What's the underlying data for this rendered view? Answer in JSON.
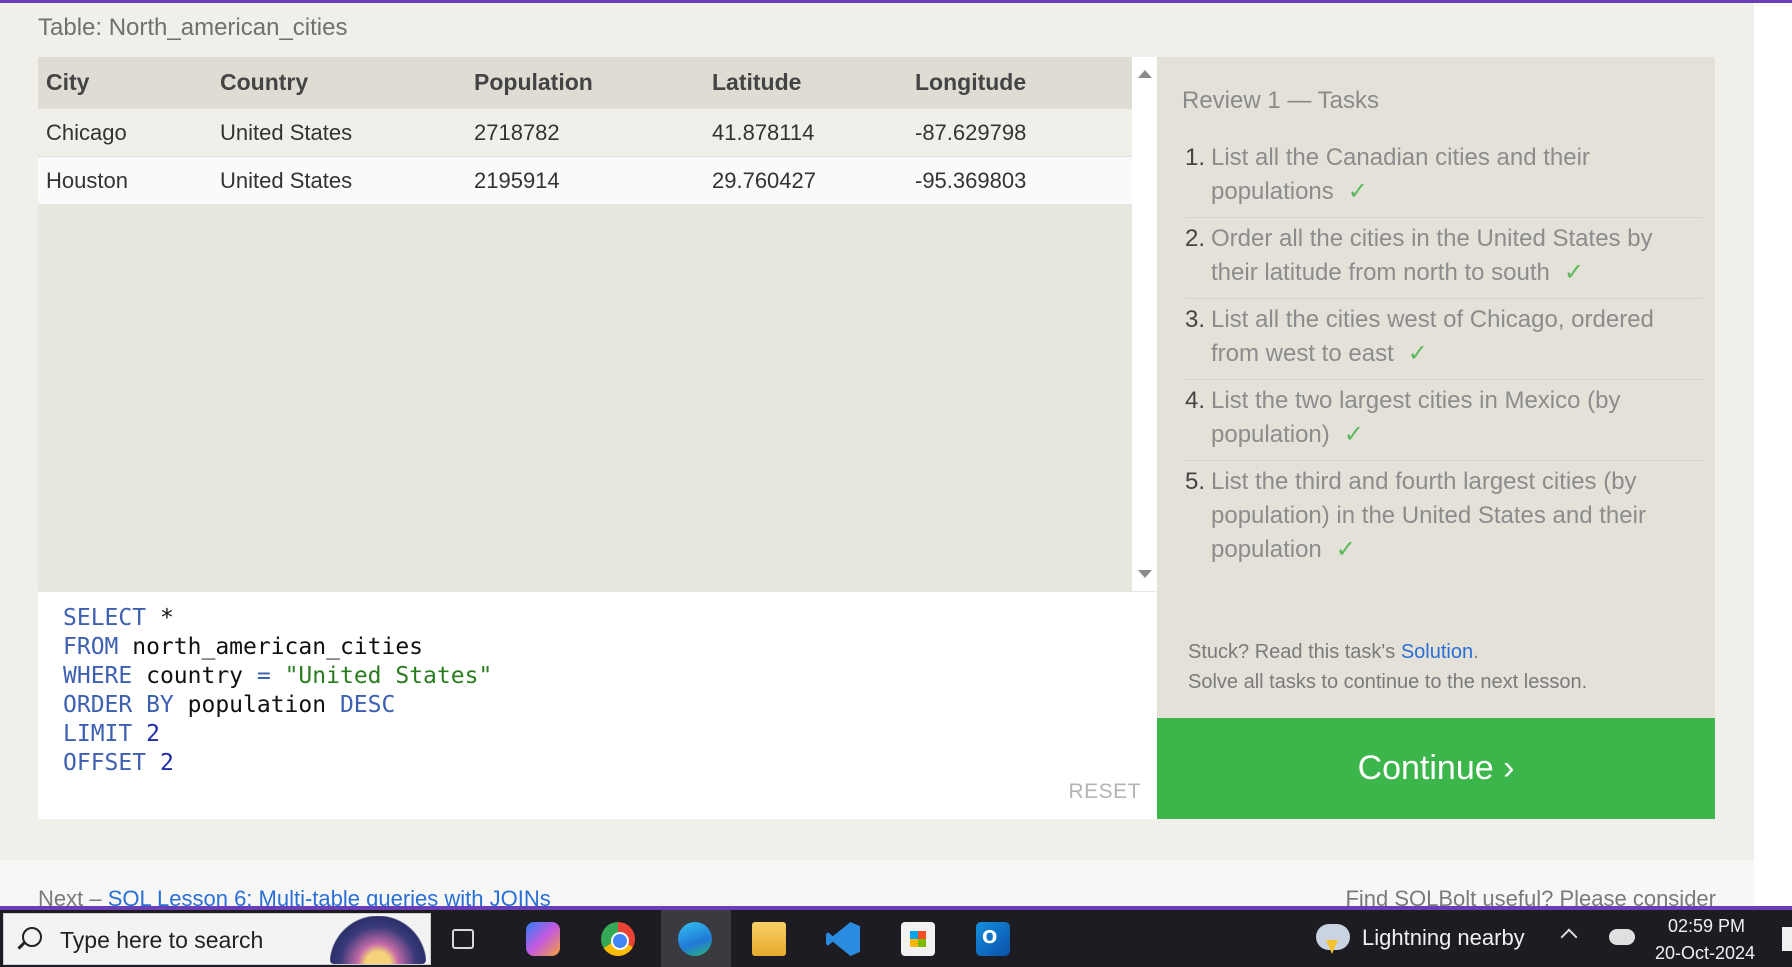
{
  "table": {
    "caption": "Table: North_american_cities",
    "columns": [
      "City",
      "Country",
      "Population",
      "Latitude",
      "Longitude"
    ],
    "rows": [
      [
        "Chicago",
        "United States",
        "2718782",
        "41.878114",
        "-87.629798"
      ],
      [
        "Houston",
        "United States",
        "2195914",
        "29.760427",
        "-95.369803"
      ]
    ]
  },
  "editor": {
    "lines": [
      [
        {
          "t": "SELECT",
          "c": "kw"
        },
        {
          "t": " *",
          "c": "id"
        }
      ],
      [
        {
          "t": "FROM",
          "c": "kw"
        },
        {
          "t": " north_american_cities",
          "c": "id"
        }
      ],
      [
        {
          "t": "WHERE",
          "c": "kw"
        },
        {
          "t": " country ",
          "c": "id"
        },
        {
          "t": "=",
          "c": "op"
        },
        {
          "t": " \"United States\"",
          "c": "str"
        }
      ],
      [
        {
          "t": "ORDER BY",
          "c": "kw"
        },
        {
          "t": " population ",
          "c": "id"
        },
        {
          "t": "DESC",
          "c": "kw"
        }
      ],
      [
        {
          "t": "LIMIT",
          "c": "kw"
        },
        {
          "t": " 2",
          "c": "num"
        }
      ],
      [
        {
          "t": "OFFSET",
          "c": "kw"
        },
        {
          "t": " 2",
          "c": "num"
        }
      ]
    ],
    "reset_label": "RESET"
  },
  "tasks": {
    "title": "Review 1 — Tasks",
    "items": [
      {
        "num": "1.",
        "text": "List all the Canadian cities and their populations",
        "done": "✓"
      },
      {
        "num": "2.",
        "text": "Order all the cities in the United States by their latitude from north to south",
        "done": "✓"
      },
      {
        "num": "3.",
        "text": "List all the cities west of Chicago, ordered from west to east",
        "done": "✓"
      },
      {
        "num": "4.",
        "text": "List the two largest cities in Mexico (by population)",
        "done": "✓"
      },
      {
        "num": "5.",
        "text": "List the third and fourth largest cities (by population) in the United States and their population",
        "done": "✓"
      }
    ],
    "stuck_prefix": "Stuck? Read this task's ",
    "solution_link": "Solution",
    "stuck_suffix": ".",
    "solve_all": "Solve all tasks to continue to the next lesson."
  },
  "continue_label": "Continue ›",
  "footer": {
    "next_prefix": "Next – ",
    "next_link": "SQL Lesson 6: Multi-table queries with JOINs",
    "support_text": "Find SQLBolt useful? Please consider"
  },
  "taskbar": {
    "search_placeholder": "Type here to search",
    "weather_text": "Lightning nearby",
    "time": "02:59 PM",
    "date": "20-Oct-2024"
  },
  "colors": {
    "accent_purple": "#6a3fb5",
    "continue_green": "#3cb64b",
    "check_green": "#5cb85c",
    "link_blue": "#2a6fd6"
  },
  "icons": [
    "search-icon",
    "task-view-icon",
    "copilot-icon",
    "chrome-icon",
    "edge-icon",
    "file-explorer-icon",
    "vscode-icon",
    "store-icon",
    "outlook-icon",
    "weather-storm-icon",
    "chevron-up-icon",
    "onedrive-cloud-icon"
  ]
}
